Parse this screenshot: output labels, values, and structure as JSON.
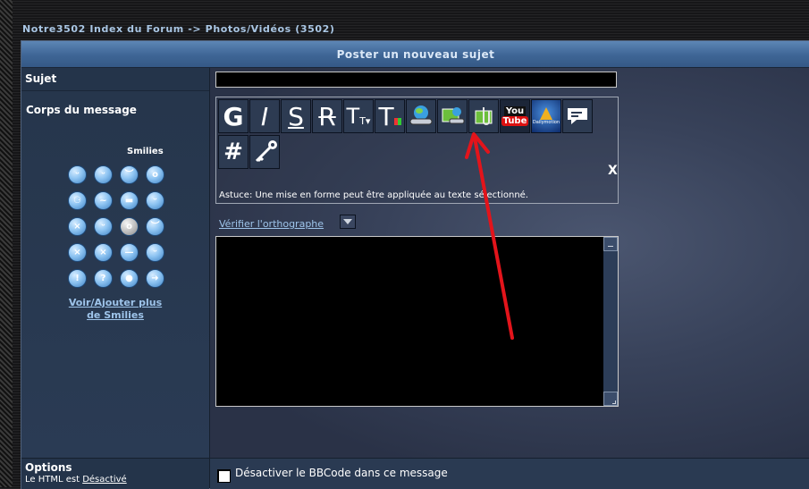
{
  "breadcrumb": {
    "home": "Notre3502 Index du Forum",
    "sep": " -> ",
    "current": "Photos/Vidéos (3502)"
  },
  "header": {
    "title": "Poster un nouveau sujet"
  },
  "form": {
    "sujet_label": "Sujet",
    "sujet_value": "",
    "corps_label": "Corps du message",
    "smilies_label": "Smilies",
    "smilies_more": "Voir/Ajouter plus de Smilies",
    "toolbar": {
      "buttons": [
        "G",
        "I",
        "S",
        "R",
        "T",
        "T",
        "image-link-icon",
        "image-upload-icon",
        "attachment-icon",
        "youtube-icon",
        "dailymotion-icon",
        "quote-icon",
        "#",
        "key-icon"
      ],
      "close": "X",
      "hint": "Astuce: Une mise en forme peut être appliquée au texte sélectionné.",
      "youtube_top": "You",
      "youtube_bottom": "Tube",
      "dailymotion": "Dailymotion"
    },
    "spell_link": "Vérifier l'orthographe",
    "message_value": ""
  },
  "options": {
    "label": "Options",
    "html_prefix": "Le HTML est ",
    "html_status": "Désactivé",
    "bbcode_label": "Désactiver le BBCode dans ce message"
  },
  "annotation": {
    "arrow_color": "#e3141b"
  }
}
